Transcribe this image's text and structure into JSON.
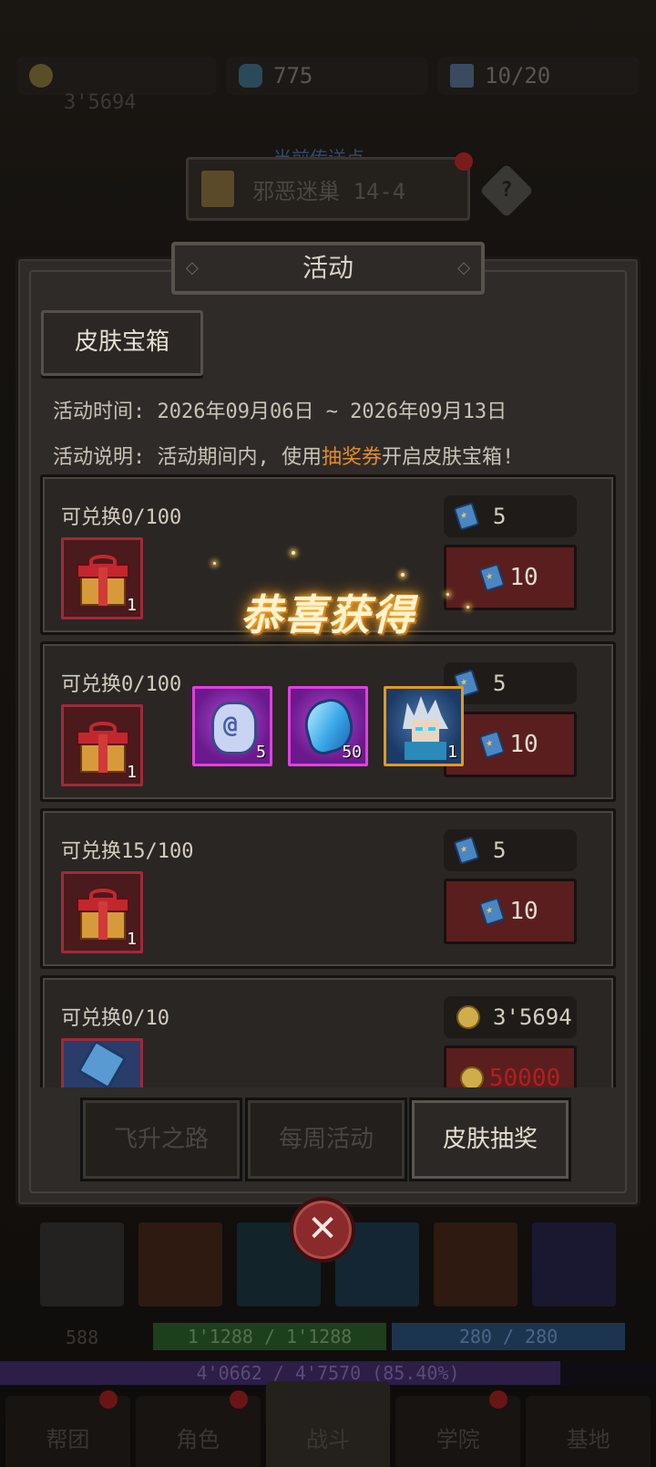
{
  "background": {
    "resources": {
      "gold": "",
      "gold_sub": "3'5694",
      "gems": "775",
      "tickets": "10/20"
    },
    "teleport": {
      "title": "当前传送点",
      "location": "邪恶迷巢 14-4"
    },
    "player": {
      "level_label": "588",
      "hp": "1'1288 / 1'1288",
      "mp": "280 / 280",
      "xp": "4'0662 / 4'7570 (85.40%)",
      "xp_fraction": 0.854
    },
    "nav": [
      {
        "label": "帮团",
        "dot": true
      },
      {
        "label": "角色",
        "dot": true
      },
      {
        "label": "战斗",
        "dot": false
      },
      {
        "label": "学院",
        "dot": true
      },
      {
        "label": "基地",
        "dot": false
      }
    ]
  },
  "modal": {
    "title": "活动",
    "tab": "皮肤宝箱",
    "time_line": "活动时间: 2026年09月06日 ~ 2026年09月13日",
    "desc_prefix": "活动说明: 活动期间内, 使用",
    "desc_highlight": "抽奖券",
    "desc_suffix": "开启皮肤宝箱!",
    "highlight_color": "#e28b2c",
    "items": [
      {
        "label": "可兑换0/100",
        "qty": "1",
        "icon": "gift-box-icon",
        "small_cost": "5",
        "buy_cost": "10",
        "currency": "ticket-icon"
      },
      {
        "label": "可兑换0/100",
        "qty": "1",
        "icon": "gift-box-icon",
        "small_cost": "5",
        "buy_cost": "10",
        "currency": "ticket-icon"
      },
      {
        "label": "可兑换15/100",
        "qty": "1",
        "icon": "gift-box-icon",
        "small_cost": "5",
        "buy_cost": "10",
        "currency": "ticket-icon"
      },
      {
        "label": "可兑换0/10",
        "qty": "",
        "icon": "blue-shard-icon",
        "small_cost": "3'5694",
        "buy_cost": "50000",
        "currency": "coin-icon"
      }
    ],
    "bottom_tabs": [
      "飞升之路",
      "每周活动",
      "皮肤抽奖"
    ]
  },
  "reward_popup": {
    "title": "恭喜获得",
    "rewards": [
      {
        "icon": "rune-stone-icon",
        "qty": "5"
      },
      {
        "icon": "blue-crystal-icon",
        "qty": "50"
      },
      {
        "icon": "hero-skin-portrait-icon",
        "qty": "1"
      }
    ],
    "close_icon": "close-icon"
  }
}
